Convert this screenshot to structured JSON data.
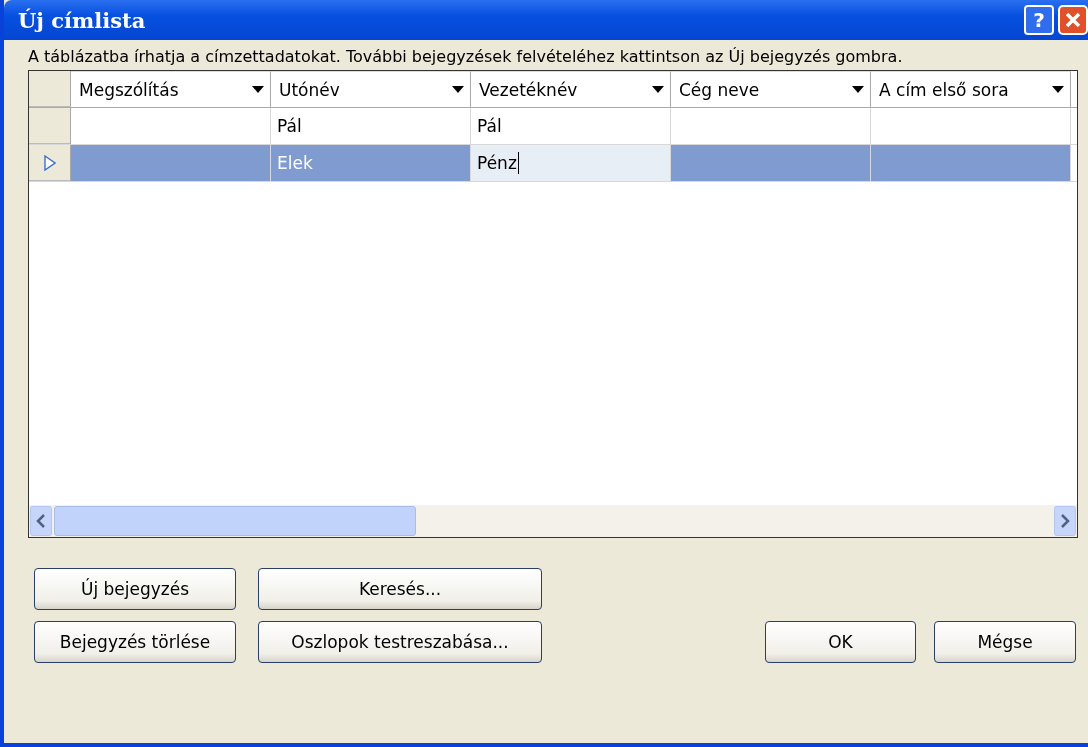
{
  "window": {
    "title": "Új címlista",
    "help_button": "?"
  },
  "description": "A táblázatba írhatja a címzettadatokat. További bejegyzések felvételéhez kattintson az Új bejegyzés gombra.",
  "table": {
    "columns": [
      {
        "label": "Megszólítás"
      },
      {
        "label": "Utónév"
      },
      {
        "label": "Vezetéknév"
      },
      {
        "label": "Cég neve"
      },
      {
        "label": "A cím első sora"
      }
    ],
    "rows": [
      {
        "selected": false,
        "cells": [
          {
            "text": "",
            "editing": false
          },
          {
            "text": "Pál",
            "editing": false
          },
          {
            "text": "Pál",
            "editing": false
          },
          {
            "text": "",
            "editing": false
          },
          {
            "text": "",
            "editing": false
          }
        ]
      },
      {
        "selected": true,
        "cells": [
          {
            "text": "",
            "editing": false
          },
          {
            "text": "Elek",
            "editing": false
          },
          {
            "text": "Pénz",
            "editing": true
          },
          {
            "text": "",
            "editing": false
          },
          {
            "text": "",
            "editing": false
          }
        ]
      }
    ]
  },
  "buttons_left": [
    [
      "Új bejegyzés",
      "Keresés..."
    ],
    [
      "Bejegyzés törlése",
      "Oszlopok testreszabása..."
    ]
  ],
  "buttons_right": [
    "OK",
    "Mégse"
  ]
}
